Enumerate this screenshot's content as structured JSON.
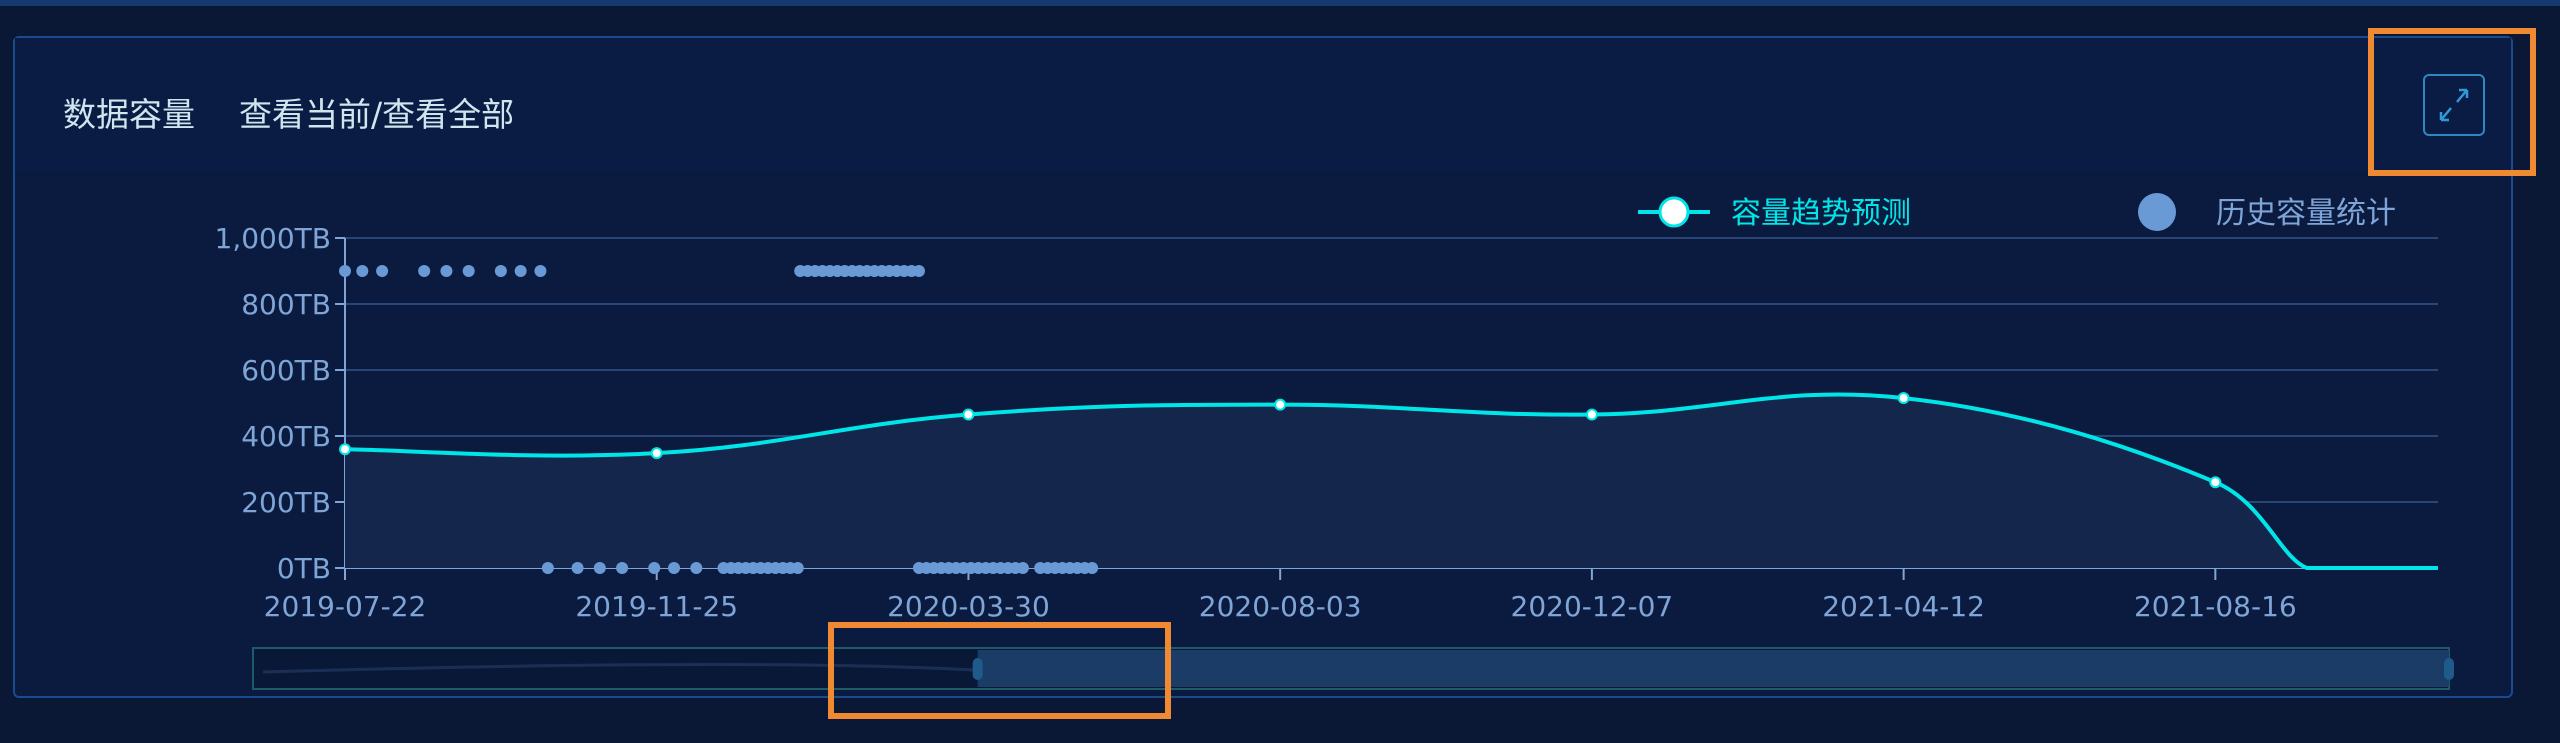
{
  "header": {
    "title": "数据容量",
    "view_toggle": "查看当前/查看全部"
  },
  "icons": {
    "expand": "expand-icon"
  },
  "colors": {
    "forecast": "#00e5e8",
    "history": "#6a9ad6",
    "highlight": "#f08a32"
  },
  "chart_data": {
    "type": "line",
    "x_unit": "days since 2019-07-22",
    "x_range": [
      0,
      846
    ],
    "ylim": [
      0,
      1000
    ],
    "y_ticks": [
      "0TB",
      "200TB",
      "400TB",
      "600TB",
      "800TB",
      "1,000TB"
    ],
    "y_tick_values": [
      0,
      200,
      400,
      600,
      800,
      1000
    ],
    "x_ticks": [
      "2019-07-22",
      "2019-11-25",
      "2020-03-30",
      "2020-08-03",
      "2020-12-07",
      "2021-04-12",
      "2021-08-16"
    ],
    "x_tick_values": [
      0,
      126,
      252,
      378,
      504,
      630,
      756
    ],
    "legend": [
      "容量趋势预测",
      "历史容量统计"
    ],
    "legend_placement": "top-right",
    "series": [
      {
        "name": "容量趋势预测",
        "type": "line",
        "smooth": true,
        "x": [
          0,
          126,
          252,
          378,
          504,
          630,
          756,
          793,
          846
        ],
        "y": [
          360,
          348,
          465,
          495,
          465,
          515,
          260,
          0,
          0
        ],
        "markers": [
          0,
          1,
          2,
          3,
          4,
          5,
          6
        ]
      },
      {
        "name": "历史容量统计",
        "type": "scatter",
        "points_900": [
          0,
          7,
          15,
          32,
          41,
          50,
          63,
          71,
          79
        ],
        "segments_900": [
          [
            184,
            234
          ]
        ],
        "points_0": [
          82,
          94,
          103,
          112,
          125,
          133,
          142
        ],
        "segments_0": [
          [
            153,
            183
          ],
          [
            232,
            275
          ],
          [
            281,
            302
          ]
        ]
      }
    ],
    "zoom_range_percent": [
      33,
      100
    ]
  }
}
